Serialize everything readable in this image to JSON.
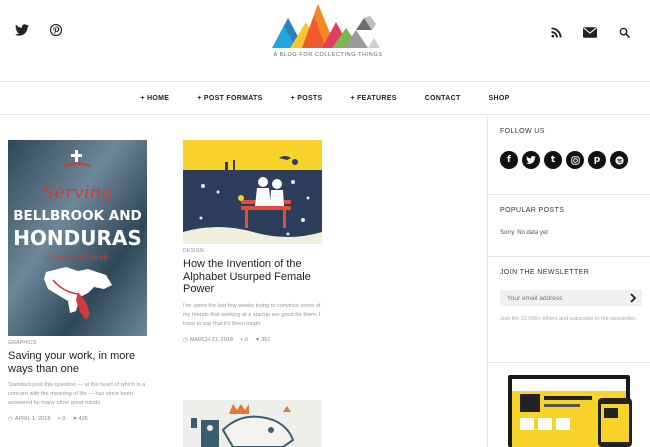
{
  "header": {
    "tagline": "A BLOG FOR COLLECTING THINGS",
    "social": [
      "twitter-icon",
      "pinterest-icon"
    ],
    "utility": [
      "rss-icon",
      "mail-icon",
      "search-icon"
    ]
  },
  "nav": {
    "items": [
      {
        "label": "+ HOME"
      },
      {
        "label": "+ POST FORMATS"
      },
      {
        "label": "+ POSTS"
      },
      {
        "label": "+ FEATURES"
      },
      {
        "label": "CONTACT"
      },
      {
        "label": "SHOP"
      }
    ]
  },
  "posts": [
    {
      "category": "GRAPHICS",
      "title": "Saving your work, in more ways than one",
      "excerpt": "Standard post this question — at the heart of which is a concern with the meaning of life — has since been answered by many other great minds.",
      "date": "APRIL 1, 2018",
      "comments": "0",
      "likes": "426",
      "image_text": {
        "line1": "Serving",
        "line2": "BELLBROOK AND",
        "line3": "HONDURAS",
        "line4": "CovenantCreek"
      }
    },
    {
      "category": "DESIGN",
      "title": "How the Invention of the Alphabet Usurped Female Power",
      "excerpt": "I've spent the last few weeks trying to convince some of my friends that working at a startup are good for them. I have to say that it's been tough.",
      "date": "MARCH 31, 2018",
      "comments": "0",
      "likes": "351"
    }
  ],
  "sidebar": {
    "follow_title": "FOLLOW US",
    "follow_icons": [
      "facebook-icon",
      "twitter-icon",
      "tumblr-icon",
      "instagram-icon",
      "pinterest-icon",
      "spotify-icon"
    ],
    "popular_title": "POPULAR POSTS",
    "popular_empty": "Sorry. No data yet",
    "newsletter_title": "JOIN THE NEWSLETTER",
    "newsletter_placeholder": "Your email address",
    "newsletter_join": "Join the 12.000+ others and subscribe to the newsletter."
  },
  "colors": {
    "accent": "#f7d329",
    "poster_blue": "#3d5f77",
    "poster_red": "#cf3b3b",
    "nav_text": "#222222"
  }
}
